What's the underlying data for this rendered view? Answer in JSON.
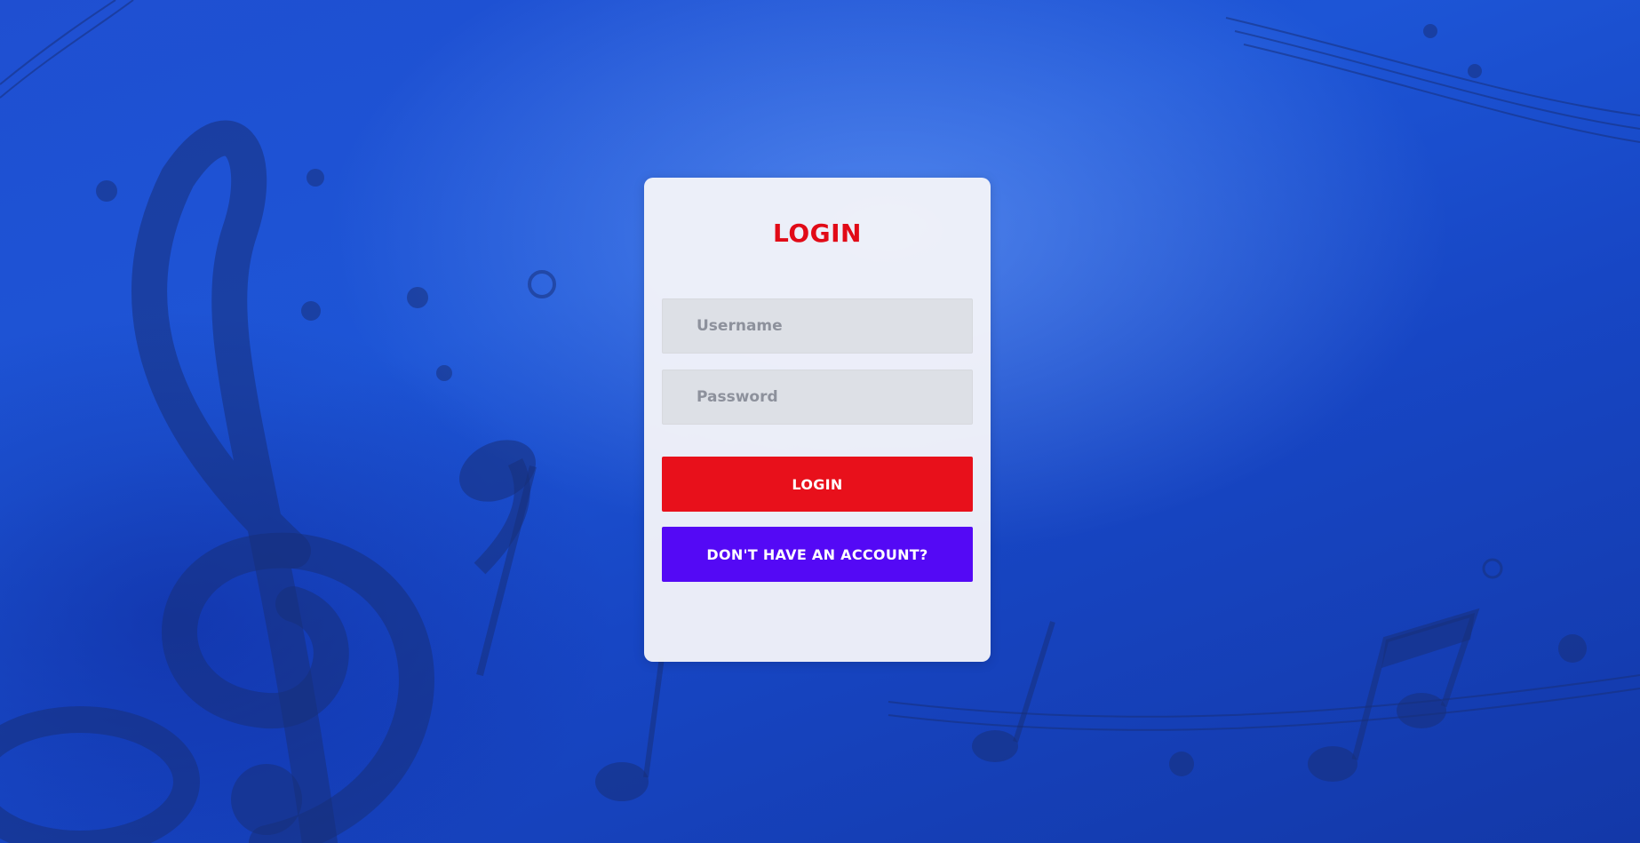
{
  "colors": {
    "background": "#1d50d2",
    "card": "#f4f5f9",
    "title": "#e10a17",
    "login_button": "#e8101b",
    "signup_button": "#5409f5",
    "field": "#dde0e6"
  },
  "background": {
    "theme_icons": [
      "treble-clef-icon",
      "music-note-icon"
    ]
  },
  "login_form": {
    "title": "LOGIN",
    "username_placeholder": "Username",
    "username_value": "",
    "password_placeholder": "Password",
    "password_value": "",
    "login_label": "LOGIN",
    "signup_label": "DON'T HAVE AN ACCOUNT?"
  }
}
